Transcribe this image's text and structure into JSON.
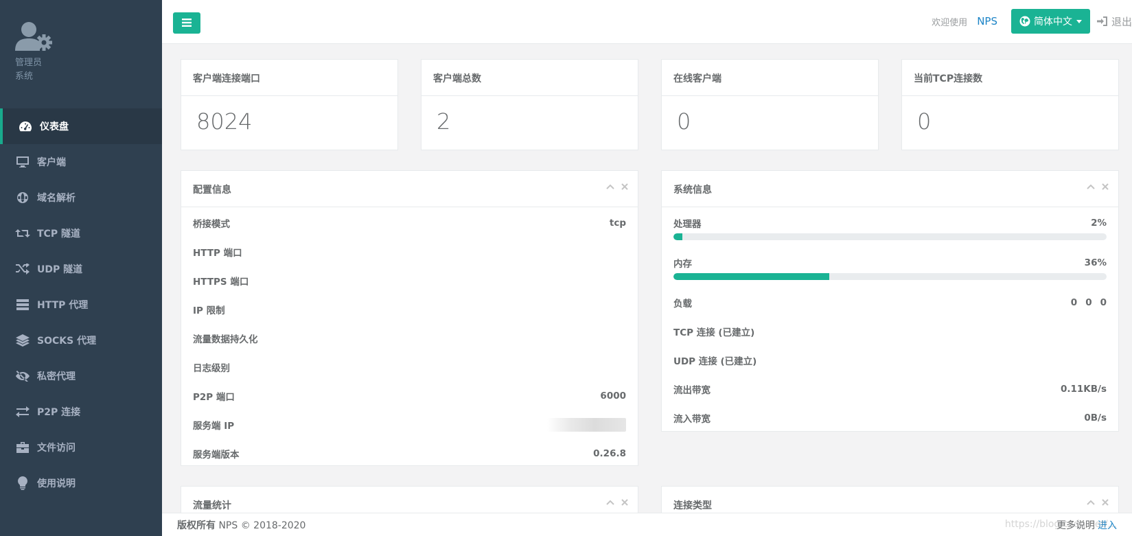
{
  "sidebar": {
    "profile": {
      "role": "管理员",
      "subrole": "系统"
    },
    "items": [
      {
        "label": "仪表盘",
        "icon": "dashboard-icon",
        "active": true
      },
      {
        "label": "客户端",
        "icon": "desktop-icon"
      },
      {
        "label": "域名解析",
        "icon": "globe-icon"
      },
      {
        "label": "TCP 隧道",
        "icon": "retweet-icon"
      },
      {
        "label": "UDP 隧道",
        "icon": "random-icon"
      },
      {
        "label": "HTTP 代理",
        "icon": "server-icon"
      },
      {
        "label": "SOCKS 代理",
        "icon": "layers-icon"
      },
      {
        "label": "私密代理",
        "icon": "eye-slash-icon"
      },
      {
        "label": "P2P 连接",
        "icon": "exchange-icon"
      },
      {
        "label": "文件访问",
        "icon": "briefcase-icon"
      },
      {
        "label": "使用说明",
        "icon": "lightbulb-icon"
      }
    ]
  },
  "topbar": {
    "welcome": "欢迎使用",
    "brand": "NPS",
    "language": "简体中文",
    "logout": "退出"
  },
  "stats": [
    {
      "title": "客户端连接端口",
      "value": "8024"
    },
    {
      "title": "客户端总数",
      "value": "2"
    },
    {
      "title": "在线客户端",
      "value": "0"
    },
    {
      "title": "当前TCP连接数",
      "value": "0"
    }
  ],
  "config": {
    "title": "配置信息",
    "rows": [
      {
        "label": "桥接模式",
        "value": "tcp"
      },
      {
        "label": "HTTP 端口",
        "value": ""
      },
      {
        "label": "HTTPS 端口",
        "value": ""
      },
      {
        "label": "IP 限制",
        "value": ""
      },
      {
        "label": "流量数据持久化",
        "value": ""
      },
      {
        "label": "日志级别",
        "value": ""
      },
      {
        "label": "P2P 端口",
        "value": "6000"
      },
      {
        "label": "服务端 IP",
        "value": ""
      },
      {
        "label": "服务端版本",
        "value": "0.26.8"
      }
    ]
  },
  "system": {
    "title": "系统信息",
    "cpu": {
      "label": "处理器",
      "value": "2%",
      "percent": 2
    },
    "mem": {
      "label": "内存",
      "value": "36%",
      "percent": 36
    },
    "load": {
      "label": "负载",
      "values": [
        "0",
        "0",
        "0"
      ]
    },
    "rows": [
      {
        "label": "TCP 连接 (已建立)",
        "value": ""
      },
      {
        "label": "UDP 连接 (已建立)",
        "value": ""
      },
      {
        "label": "流出带宽",
        "value": "0.11KB/s"
      },
      {
        "label": "流入带宽",
        "value": "0B/s"
      }
    ]
  },
  "traffic": {
    "title": "流量统计"
  },
  "conntype": {
    "title": "连接类型"
  },
  "footer": {
    "copyright_bold": "版权所有",
    "copyright": "NPS © 2018-2020",
    "more": "更多说明",
    "enter": "进入"
  },
  "watermark": "https://blog.csdn.net/..."
}
